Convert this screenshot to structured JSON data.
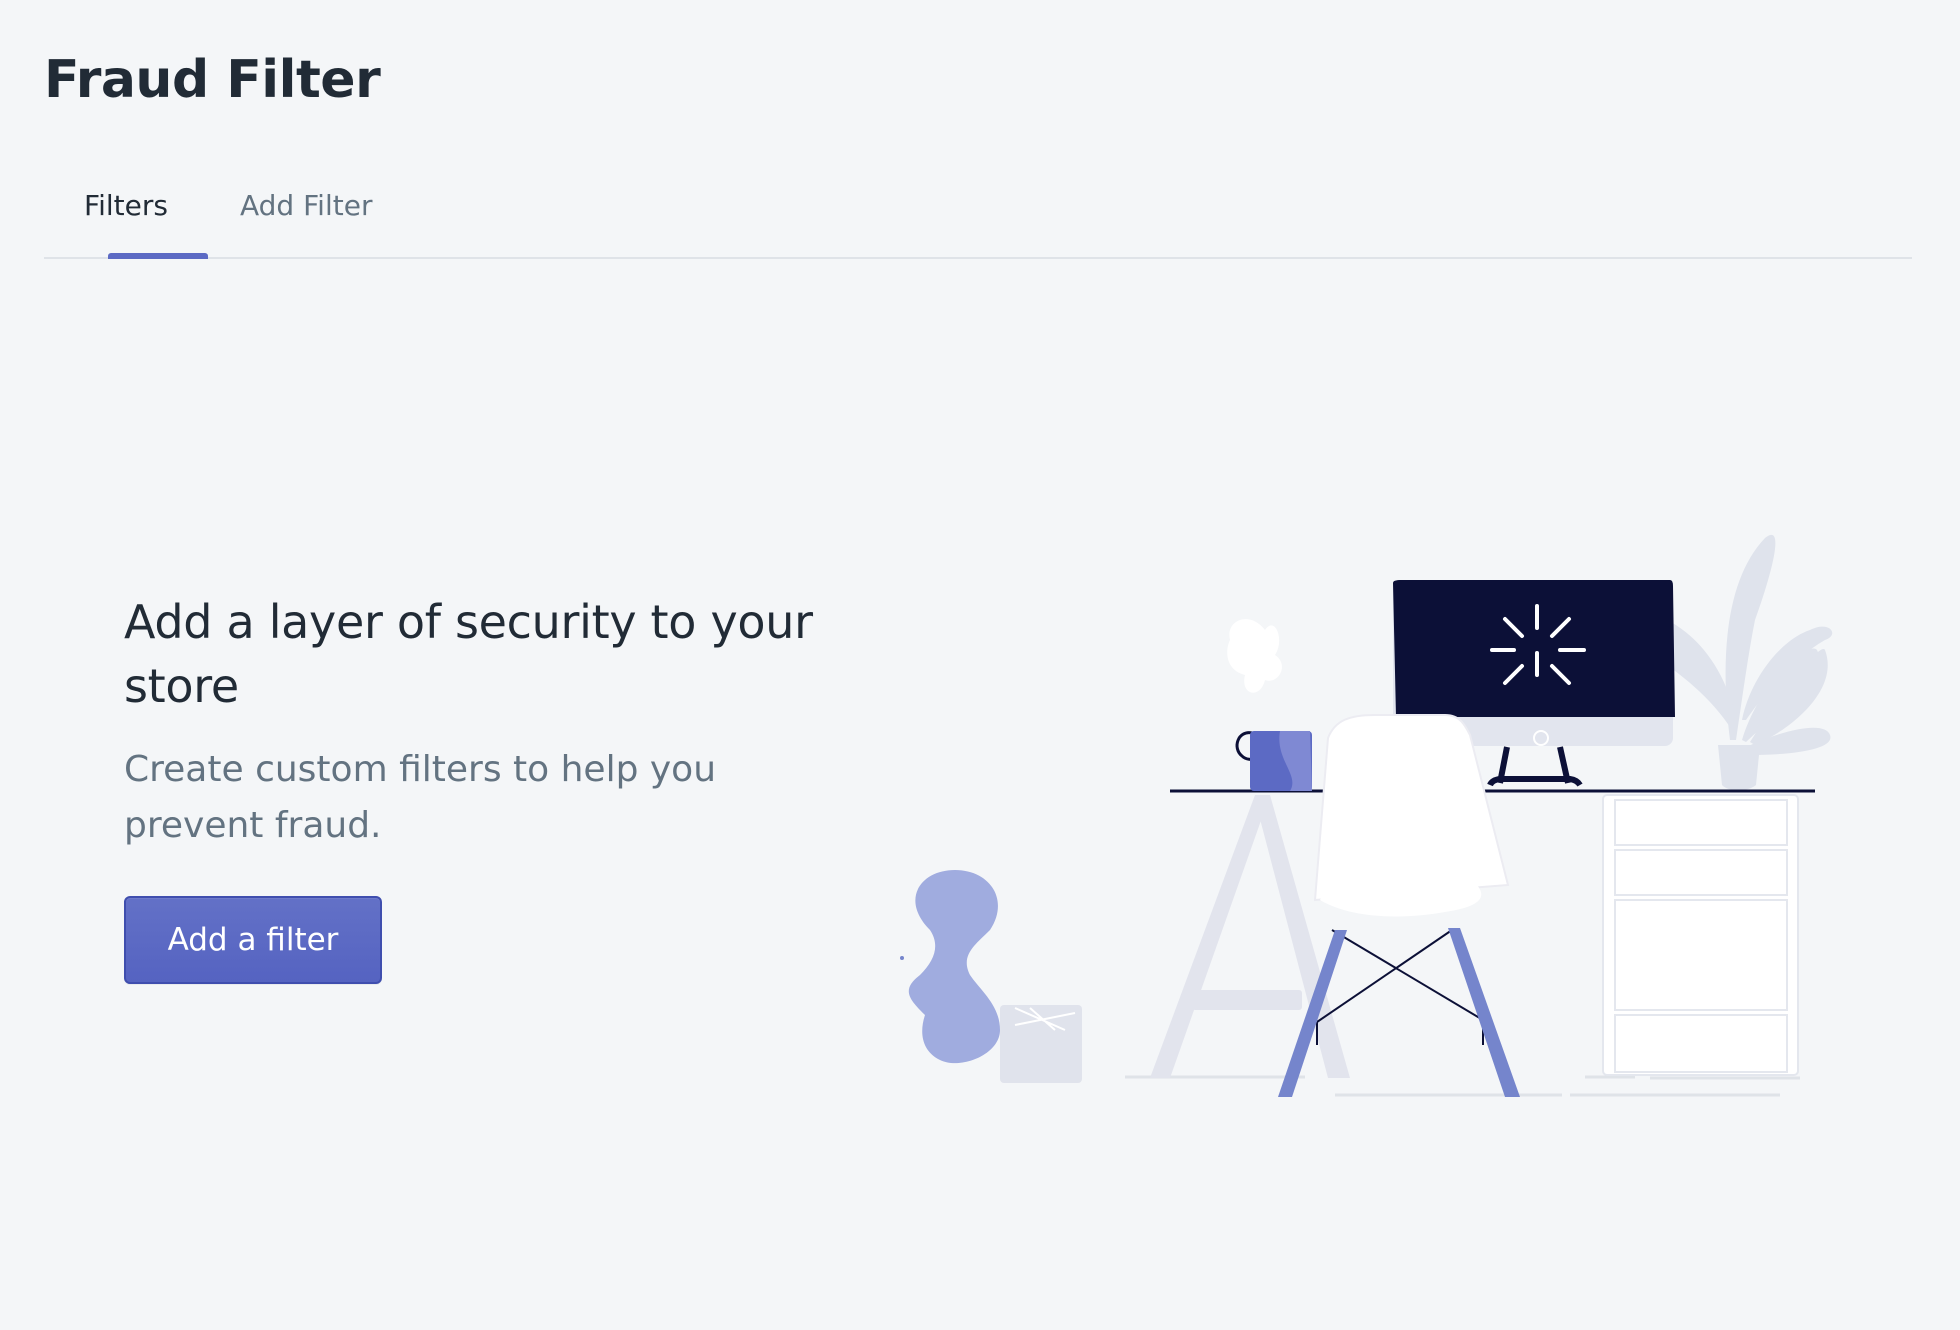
{
  "page": {
    "title": "Fraud Filter"
  },
  "tabs": [
    {
      "label": "Filters",
      "selected": true
    },
    {
      "label": "Add Filter",
      "selected": false
    }
  ],
  "empty_state": {
    "heading": "Add a layer of security to your store",
    "body": "Create custom filters to help you prevent fraud.",
    "action_label": "Add a filter"
  },
  "colors": {
    "accent": "#5c6ac4",
    "page_background": "#f4f6f8",
    "heading": "#212b36",
    "subdued_text": "#637381",
    "monitor_screen": "#0c1037"
  },
  "icons": {
    "illustration": "workspace-illustration"
  }
}
